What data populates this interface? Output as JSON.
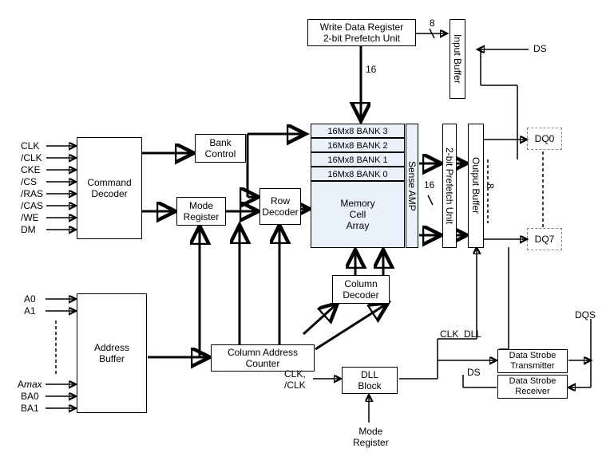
{
  "blocks": {
    "writeDataReg_l1": "Write Data Register",
    "writeDataReg_l2": "2-bit Prefetch Unit",
    "commandDecoder": "Command Decoder",
    "bankControl_l1": "Bank",
    "bankControl_l2": "Control",
    "modeRegister_l1": "Mode",
    "modeRegister_l2": "Register",
    "rowDecoder_l1": "Row",
    "rowDecoder_l2": "Decoder",
    "bank3": "16Mx8 BANK 3",
    "bank2": "16Mx8 BANK 2",
    "bank1": "16Mx8 BANK 1",
    "bank0": "16Mx8 BANK 0",
    "memoryCell_l1": "Memory",
    "memoryCell_l2": "Cell",
    "memoryCell_l3": "Array",
    "senseAmp": "Sense AMP",
    "prefetch2": "2-bit Prefetch Unit",
    "outputBuffer": "Output Buffer",
    "inputBuffer": "Input Buffer",
    "columnDecoder_l1": "Column",
    "columnDecoder_l2": "Decoder",
    "addressBuffer_l1": "Address",
    "addressBuffer_l2": "Buffer",
    "colAddrCounter_l1": "Column Address",
    "colAddrCounter_l2": "Counter",
    "dllBlock_l1": "DLL",
    "dllBlock_l2": "Block",
    "dsTransmitter_l1": "Data Strobe",
    "dsTransmitter_l2": "Transmitter",
    "dsReceiver_l1": "Data Strobe",
    "dsReceiver_l2": "Receiver"
  },
  "labels": {
    "bus8_top": "8",
    "bus16_top": "16",
    "bus16_mid": "16",
    "bus8_mid": "8",
    "ds_top": "DS",
    "dq0": "DQ0",
    "dq7": "DQ7",
    "dqs": "DQS",
    "clk_dll": "CLK_DLL",
    "ds_bottom": "DS",
    "clk_input_l1": "CLK,",
    "clk_input_l2": "/CLK",
    "modeReg_bottom_l1": "Mode",
    "modeReg_bottom_l2": "Register"
  },
  "signals_left_cmd": [
    "CLK",
    "/CLK",
    "CKE",
    "/CS",
    "/RAS",
    "/CAS",
    "/WE",
    "DM"
  ],
  "signals_left_addr_top": [
    "A0",
    "A1"
  ],
  "signals_left_addr_bot": [
    "Amax",
    "BA0",
    "BA1"
  ]
}
